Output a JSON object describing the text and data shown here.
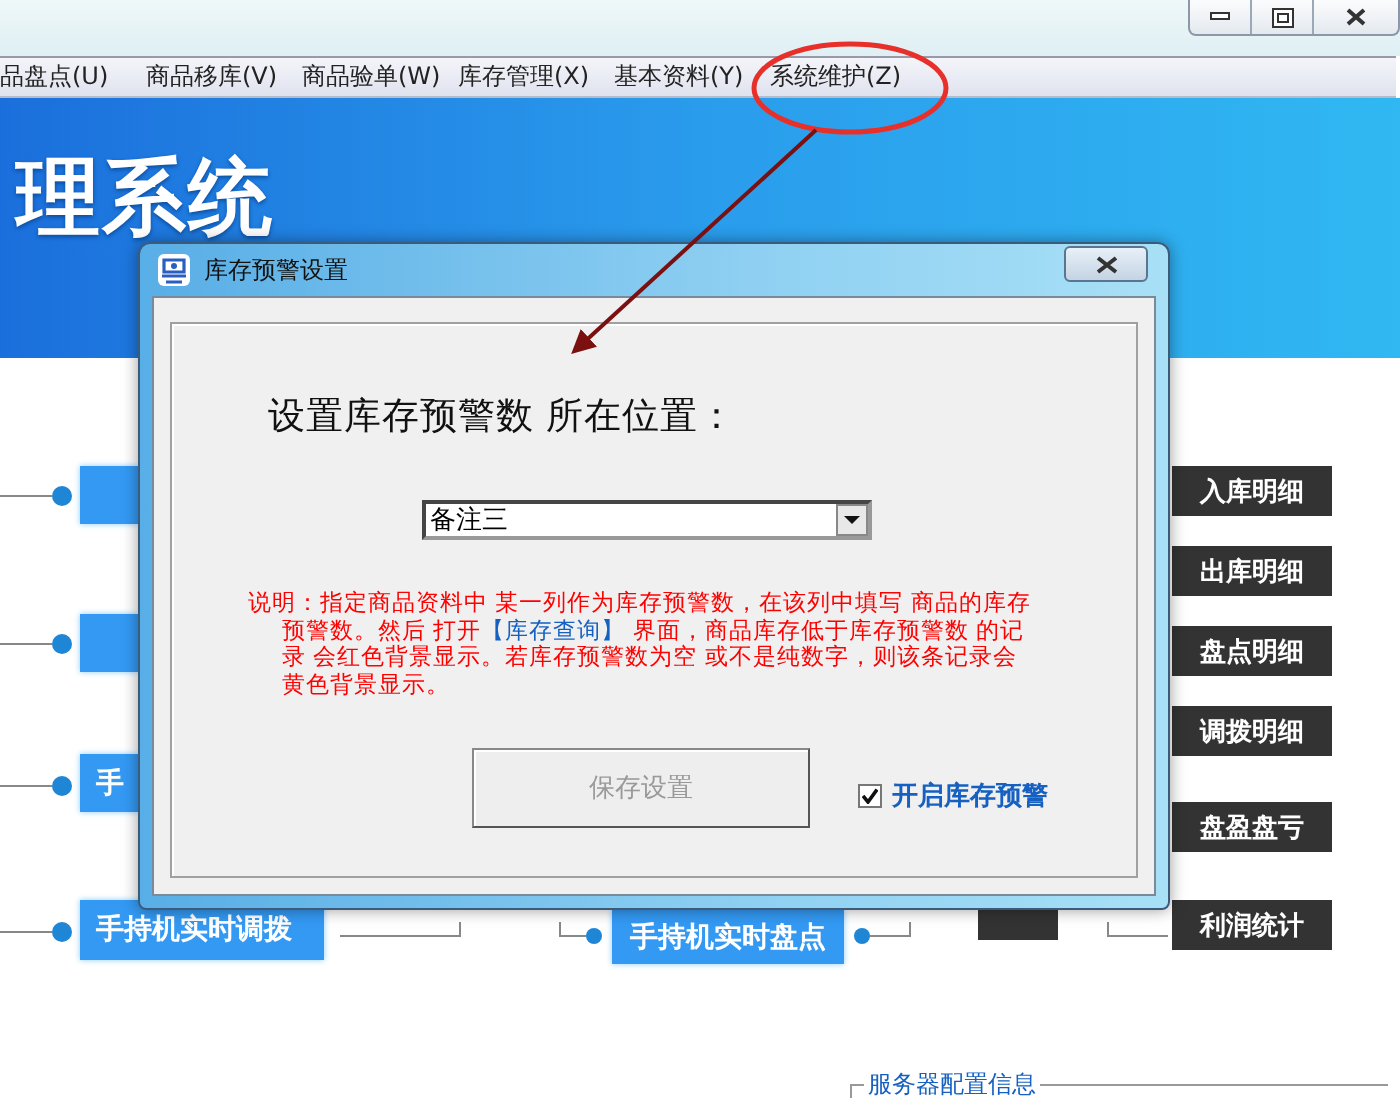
{
  "menu_bar": {
    "items": [
      {
        "label": "品盘点(U)"
      },
      {
        "label": "商品移库(V)"
      },
      {
        "label": "商品验单(W)"
      },
      {
        "label": "库存管理(X)"
      },
      {
        "label": "基本资料(Y)"
      },
      {
        "label": "系统维护(Z)"
      }
    ]
  },
  "banner": {
    "title": "理系统"
  },
  "flow": {
    "left_nodes": [
      {
        "label": "手"
      },
      {
        "label": "手持机实时调拨"
      }
    ],
    "center_nodes": [
      {
        "label": "手持机实时盘点"
      }
    ],
    "report_buttons": [
      {
        "label": "入库明细"
      },
      {
        "label": "出库明细"
      },
      {
        "label": "盘点明细"
      },
      {
        "label": "调拨明细"
      },
      {
        "label": "盘盈盘亏"
      },
      {
        "label": "利润统计"
      }
    ]
  },
  "server_info": {
    "title": "服务器配置信息"
  },
  "dialog": {
    "title": "库存预警设置",
    "heading": "设置库存预警数 所在位置：",
    "dropdown": {
      "value": "备注三"
    },
    "note": {
      "before": "说明：指定商品资料中 某一列作为库存预警数，在该列中填写 商品的库存预警数。然后 打开",
      "link": "【库存查询】",
      "after": " 界面，商品库存低于库存预警数 的记录 会红色背景显示。若库存预警数为空 或不是纯数字，则该条记录会黄色背景显示。"
    },
    "save_button": {
      "label": "保存设置",
      "disabled": true
    },
    "checkbox": {
      "label": "开启库存预警",
      "checked": true
    }
  }
}
